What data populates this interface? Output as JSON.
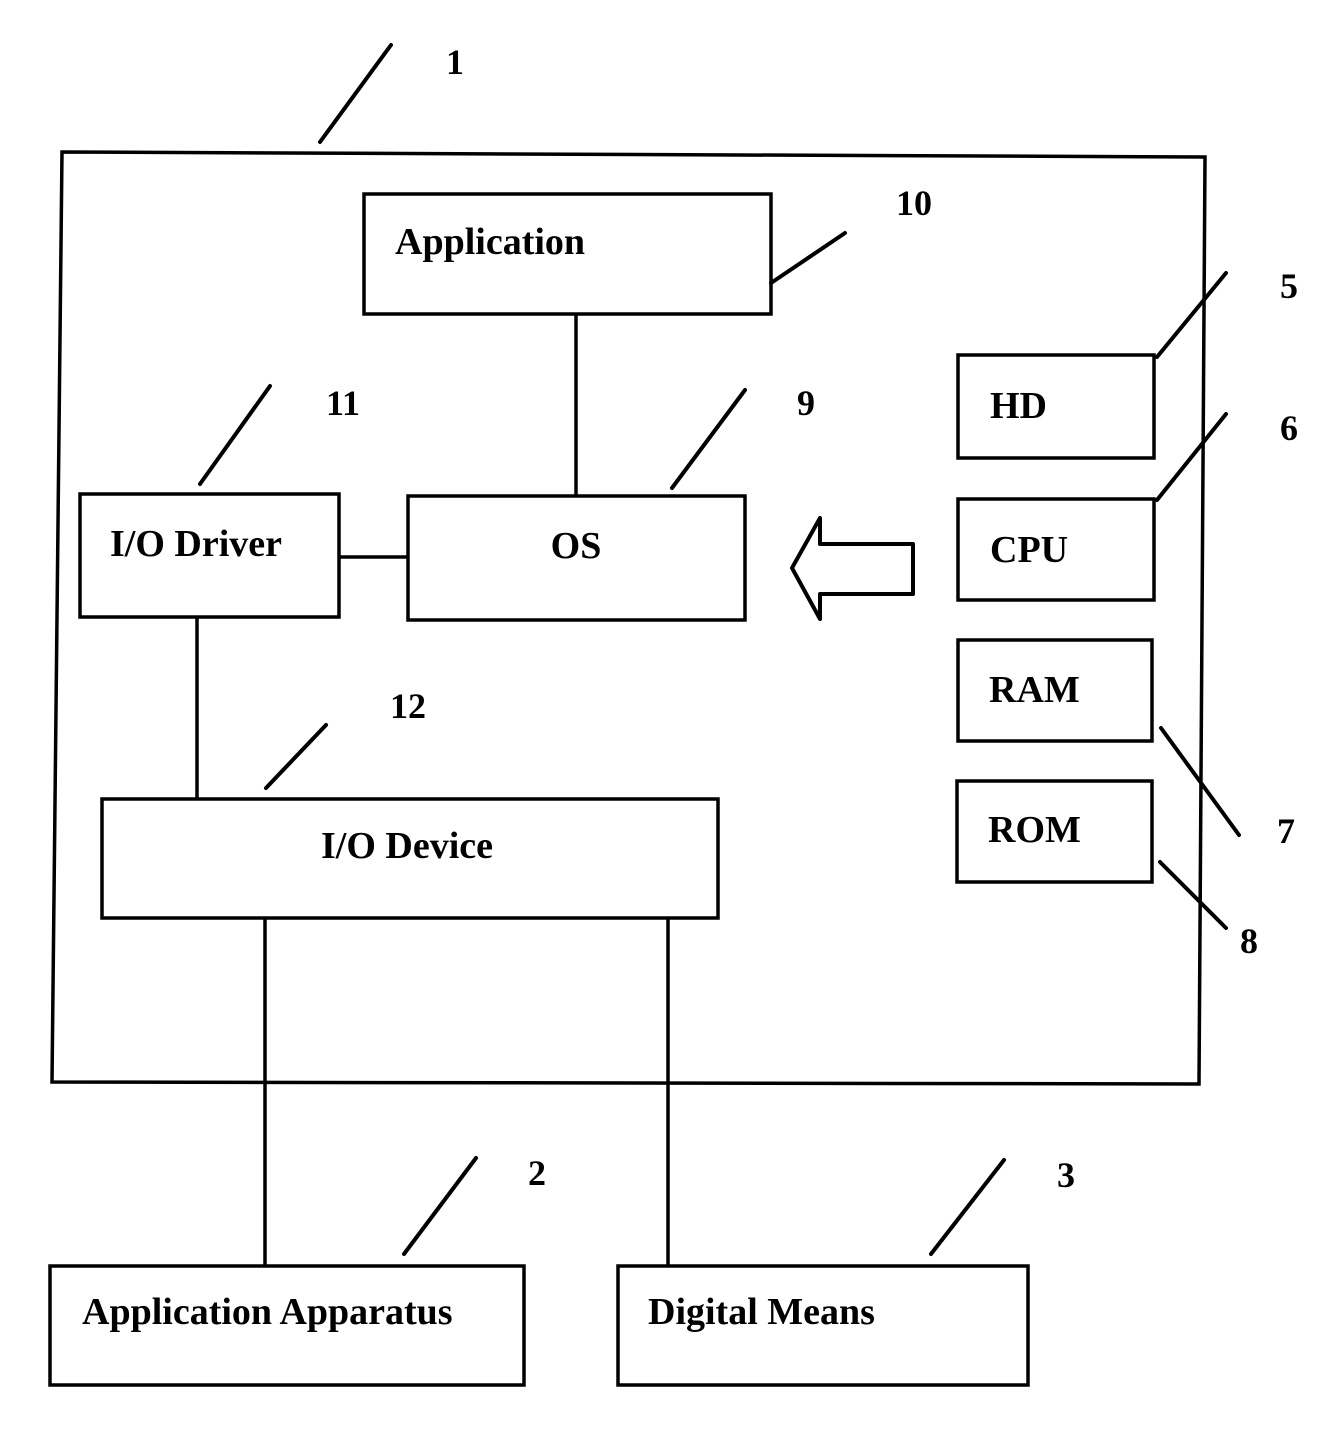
{
  "diagram": {
    "system": {
      "ref": "1"
    },
    "components": {
      "application": {
        "label": "Application",
        "ref": "10"
      },
      "os": {
        "label": "OS",
        "ref": "9"
      },
      "io_driver": {
        "label": "I/O Driver",
        "ref": "11"
      },
      "io_device": {
        "label": "I/O Device",
        "ref": "12"
      },
      "hd": {
        "label": "HD",
        "ref": "5"
      },
      "cpu": {
        "label": "CPU",
        "ref": "6"
      },
      "ram": {
        "label": "RAM",
        "ref": "7"
      },
      "rom": {
        "label": "ROM",
        "ref": "8"
      },
      "application_apparatus": {
        "label": "Application Apparatus",
        "ref": "2"
      },
      "digital_means": {
        "label": "Digital Means",
        "ref": "3"
      }
    },
    "connections": [
      [
        "application",
        "os"
      ],
      [
        "io_driver",
        "os"
      ],
      [
        "io_driver",
        "io_device"
      ],
      [
        "io_device",
        "application_apparatus"
      ],
      [
        "io_device",
        "digital_means"
      ]
    ],
    "arrow": {
      "from": "hardware (HD, CPU, RAM, ROM)",
      "to": "os",
      "direction": "left"
    }
  }
}
